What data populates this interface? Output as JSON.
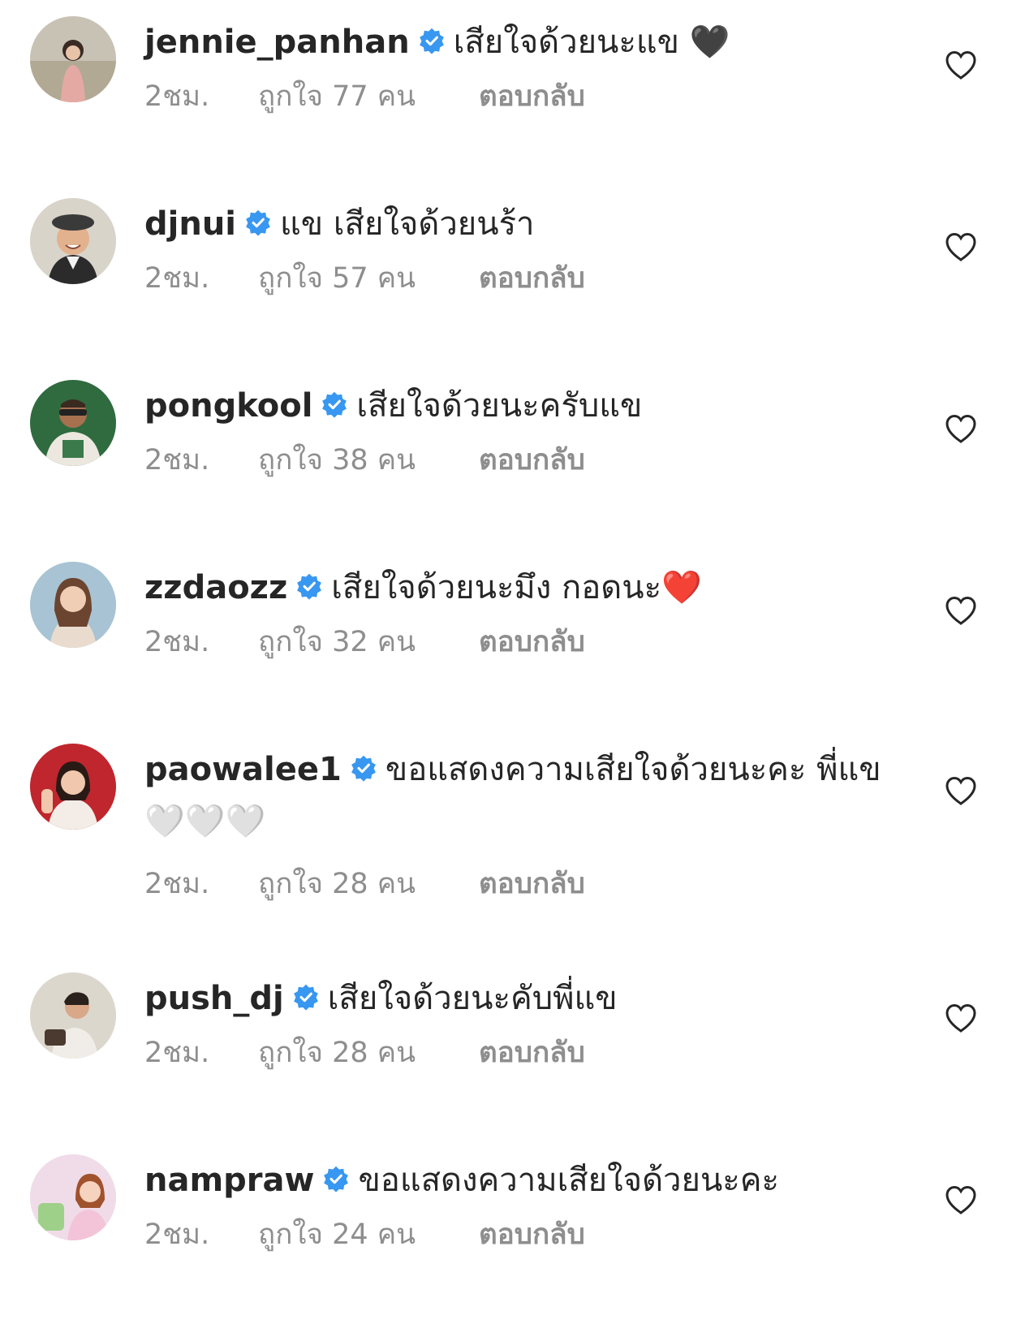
{
  "comments": [
    {
      "username": "jennie_panhan",
      "text": "เสียใจด้วยนะแข 🖤",
      "time": "2ชม.",
      "likes": "ถูกใจ 77 คน",
      "reply": "ตอบกลับ",
      "avatar_colors": [
        "#b9b3a8",
        "#c9877f"
      ]
    },
    {
      "username": "djnui",
      "text": "แข เสียใจด้วยนร้า",
      "time": "2ชม.",
      "likes": "ถูกใจ 57 คน",
      "reply": "ตอบกลับ",
      "avatar_colors": [
        "#d4cfc5",
        "#3a3a3a"
      ]
    },
    {
      "username": "pongkool",
      "text": "เสียใจด้วยนะครับแข",
      "time": "2ชม.",
      "likes": "ถูกใจ 38 คน",
      "reply": "ตอบกลับ",
      "avatar_colors": [
        "#2f6b3f",
        "#e8e4dc"
      ]
    },
    {
      "username": "zzdaozz",
      "text": "เสียใจด้วยนะมึง กอดนะ❤️",
      "time": "2ชม.",
      "likes": "ถูกใจ 32 คน",
      "reply": "ตอบกลับ",
      "avatar_colors": [
        "#9fb9c9",
        "#e2c5b3"
      ]
    },
    {
      "username": "paowalee1",
      "text": "ขอแสดงความเสียใจด้วยนะคะ พี่แข 🤍🤍🤍",
      "time": "2ชม.",
      "likes": "ถูกใจ 28 คน",
      "reply": "ตอบกลับ",
      "avatar_colors": [
        "#c0262d",
        "#f2e9e4"
      ]
    },
    {
      "username": "push_dj",
      "text": "เสียใจด้วยนะคับพี่แข",
      "time": "2ชม.",
      "likes": "ถูกใจ 28 คน",
      "reply": "ตอบกลับ",
      "avatar_colors": [
        "#d8d2c6",
        "#4a3a30"
      ]
    },
    {
      "username": "nampraw",
      "text": "ขอแสดงความเสียใจด้วยนะคะ",
      "time": "2ชม.",
      "likes": "ถูกใจ 24 คน",
      "reply": "ตอบกลับ",
      "avatar_colors": [
        "#efd6e6",
        "#9fd08a"
      ]
    }
  ],
  "colors": {
    "text": "#262626",
    "muted": "#8e8e8e",
    "verified": "#3897f0"
  },
  "icons": {
    "verified": "verified-badge-icon",
    "like": "heart-outline-icon"
  }
}
